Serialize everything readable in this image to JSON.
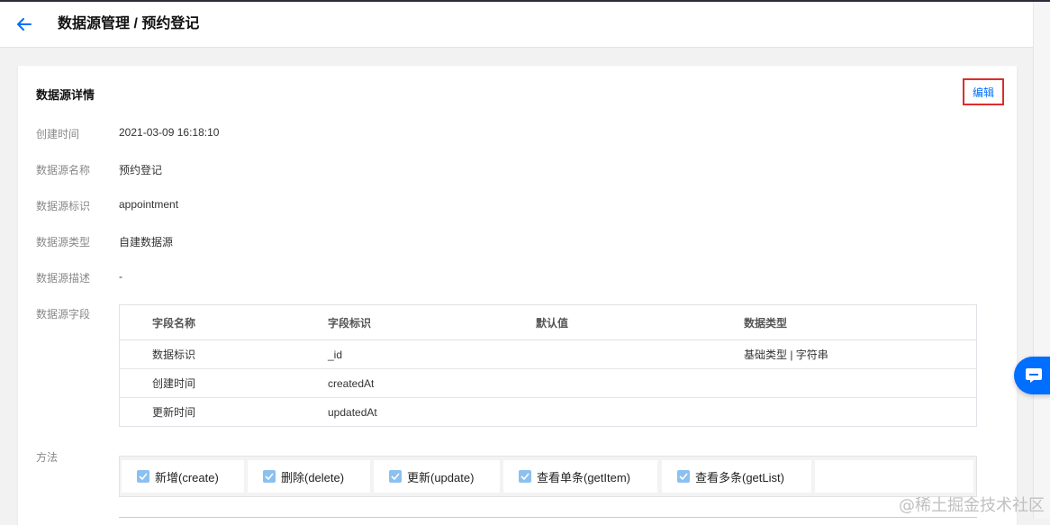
{
  "header": {
    "title": "数据源管理 / 预约登记"
  },
  "card": {
    "title": "数据源详情",
    "edit_label": "编辑",
    "rows": [
      {
        "label": "创建时间",
        "value": "2021-03-09 16:18:10"
      },
      {
        "label": "数据源名称",
        "value": "预约登记"
      },
      {
        "label": "数据源标识",
        "value": "appointment"
      },
      {
        "label": "数据源类型",
        "value": "自建数据源"
      },
      {
        "label": "数据源描述",
        "value": "-"
      }
    ],
    "fields_label": "数据源字段",
    "fields_table": {
      "headers": [
        "字段名称",
        "字段标识",
        "默认值",
        "数据类型"
      ],
      "rows": [
        [
          "数据标识",
          "_id",
          "",
          "基础类型 | 字符串"
        ],
        [
          "创建时间",
          "createdAt",
          "",
          ""
        ],
        [
          "更新时间",
          "updatedAt",
          "",
          ""
        ]
      ]
    },
    "methods_label": "方法",
    "methods": [
      {
        "label": "新增(create)",
        "checked": true
      },
      {
        "label": "删除(delete)",
        "checked": true
      },
      {
        "label": "更新(update)",
        "checked": true
      },
      {
        "label": "查看单条(getItem)",
        "checked": true
      },
      {
        "label": "查看多条(getList)",
        "checked": true
      }
    ]
  },
  "watermark": "@稀土掘金技术社区",
  "colors": {
    "accent": "#006eff",
    "highlight": "#e02b2b",
    "checkbox": "#8cc0ef"
  }
}
